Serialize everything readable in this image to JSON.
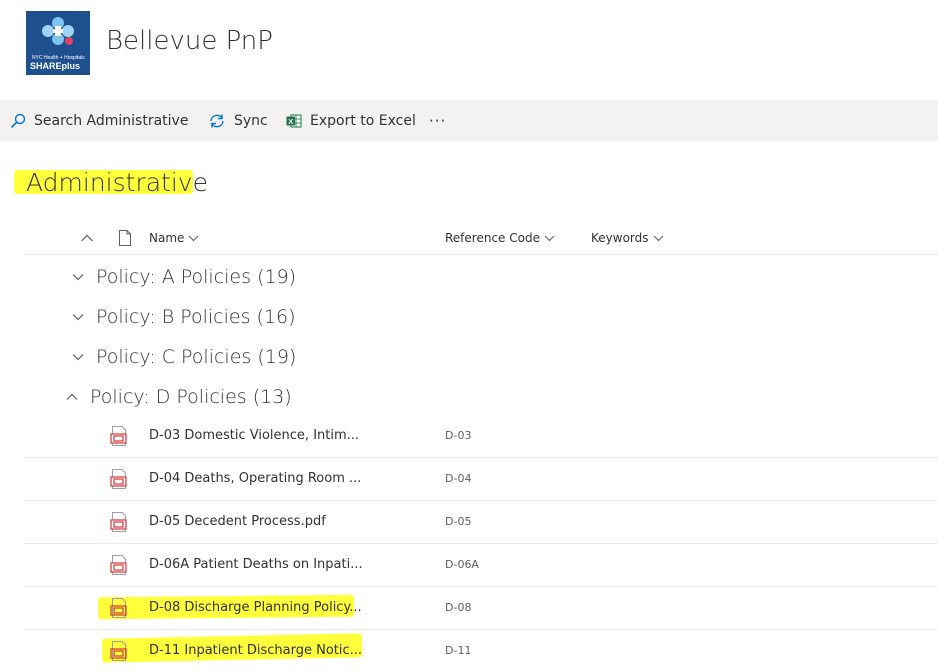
{
  "header": {
    "site_title": "Bellevue PnP",
    "logo_line1": "NYC Health + Hospitals",
    "logo_line2": "SHAREplus"
  },
  "commandbar": {
    "search_label": "Search Administrative",
    "sync_label": "Sync",
    "export_label": "Export to Excel",
    "more_label": "···"
  },
  "page": {
    "title": "Administrative"
  },
  "columns": {
    "name": "Name",
    "reference_code": "Reference Code",
    "keywords": "Keywords"
  },
  "groups": [
    {
      "label": "Policy: A Policies (19)",
      "expanded": false
    },
    {
      "label": "Policy: B Policies (16)",
      "expanded": false
    },
    {
      "label": "Policy: C Policies (19)",
      "expanded": false
    },
    {
      "label": "Policy: D Policies (13)",
      "expanded": true
    }
  ],
  "files": [
    {
      "name": "D-03 Domestic Violence, Intim...",
      "code": "D-03",
      "highlighted": false
    },
    {
      "name": "D-04 Deaths, Operating Room ...",
      "code": "D-04",
      "highlighted": false
    },
    {
      "name": "D-05 Decedent Process.pdf",
      "code": "D-05",
      "highlighted": false
    },
    {
      "name": "D-06A Patient Deaths on Inpati...",
      "code": "D-06A",
      "highlighted": false
    },
    {
      "name": "D-08 Discharge Planning Policy...",
      "code": "D-08",
      "highlighted": true
    },
    {
      "name": "D-11 Inpatient Discharge Notic...",
      "code": "D-11",
      "highlighted": true
    }
  ],
  "colors": {
    "accent": "#0078d4",
    "pdf_red": "#d13438",
    "excel_green": "#217346",
    "highlight": "#ffff3c",
    "logo_bg": "#1e4f8f"
  }
}
